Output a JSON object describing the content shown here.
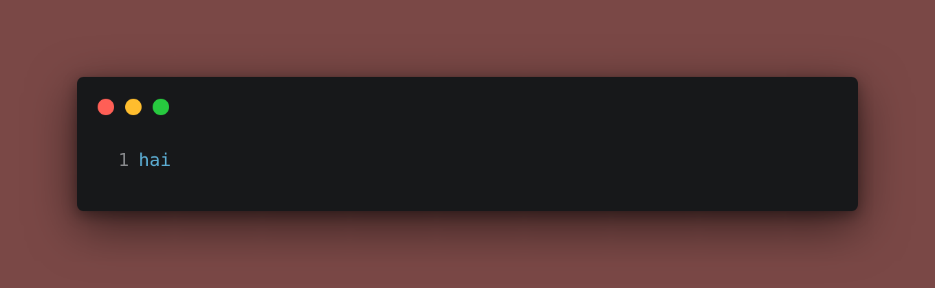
{
  "window": {
    "controls": [
      {
        "name": "close",
        "color": "#ff5f56"
      },
      {
        "name": "minimize",
        "color": "#ffbd2e"
      },
      {
        "name": "maximize",
        "color": "#27c93f"
      }
    ]
  },
  "code": {
    "lines": [
      {
        "number": "1",
        "text": "hai"
      }
    ]
  },
  "colors": {
    "background": "#7a4846",
    "window": "#17181a",
    "line_number": "#8a8b8e",
    "code_text": "#5db0d7"
  }
}
